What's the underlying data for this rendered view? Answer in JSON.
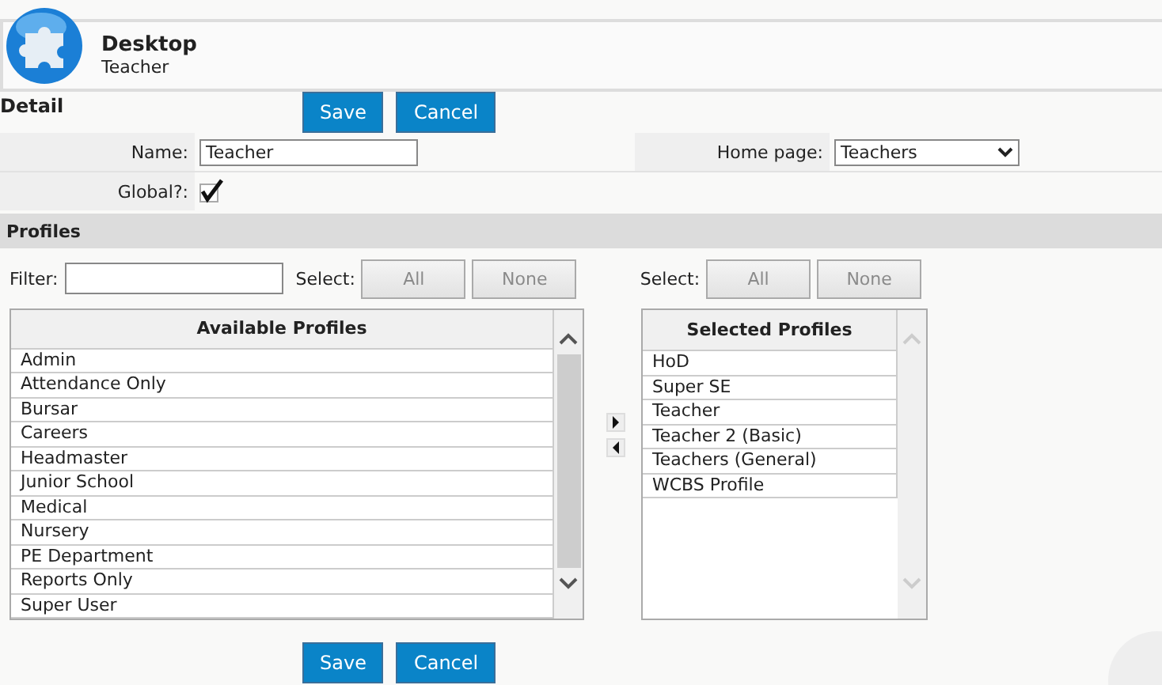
{
  "header": {
    "title": "Desktop",
    "subtitle": "Teacher"
  },
  "detail": {
    "title": "Detail",
    "buttons": [
      "Save",
      "Cancel"
    ]
  },
  "fields": {
    "name_label": "Name:",
    "name_value": "Teacher",
    "home_label": "Home page:",
    "home_value": "Teachers",
    "global_label": "Global?:",
    "global_checked": true
  },
  "profiles": {
    "title": "Profiles",
    "filter_label": "Filter:",
    "left_select": {
      "label": "Select:",
      "buttons": [
        {
          "label": "All",
          "disabled": true
        },
        {
          "label": "None",
          "disabled": true
        }
      ]
    },
    "right_select": {
      "label": "Select:",
      "buttons": [
        {
          "label": "All",
          "disabled": true
        },
        {
          "label": "None",
          "disabled": true
        }
      ]
    },
    "available": {
      "heading": "Available Profiles",
      "items": [
        "Admin",
        "Attendance Only",
        "Bursar",
        "Careers",
        "Headmaster",
        "Junior School",
        "Medical",
        "Nursery",
        "PE Department",
        "Reports Only",
        "Super User"
      ]
    },
    "selected": {
      "heading": "Selected Profiles",
      "items": [
        "HoD",
        "Super SE",
        "Teacher",
        "Teacher 2 (Basic)",
        "Teachers (General)",
        "WCBS Profile"
      ]
    }
  },
  "footer_buttons": [
    "Save",
    "Cancel"
  ]
}
